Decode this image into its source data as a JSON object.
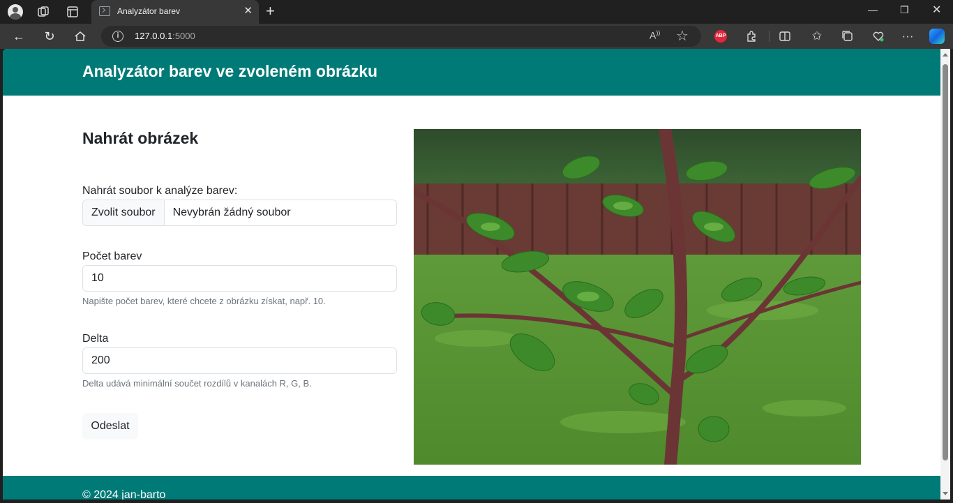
{
  "browser": {
    "tab_title": "Analyzátor barev",
    "url_host": "127.0.0.1",
    "url_port": ":5000"
  },
  "page": {
    "title": "Analyzátor barev ve zvoleném obrázku",
    "form": {
      "heading": "Nahrát obrázek",
      "file_label": "Nahrát soubor k analýze barev:",
      "file_button": "Zvolit soubor",
      "file_status": "Nevybrán žádný soubor",
      "count_label": "Počet barev",
      "count_value": "10",
      "count_help": "Napište počet barev, které chcete z obrázku získat, např. 10.",
      "delta_label": "Delta",
      "delta_value": "200",
      "delta_help": "Delta udává minimální součet rozdílů v kanalách R, G, B.",
      "submit": "Odeslat"
    },
    "footer": "© 2024 jan-barto"
  },
  "colors": {
    "brand": "#007a77",
    "chrome_dark": "#202020",
    "chrome_bar": "#383838"
  }
}
